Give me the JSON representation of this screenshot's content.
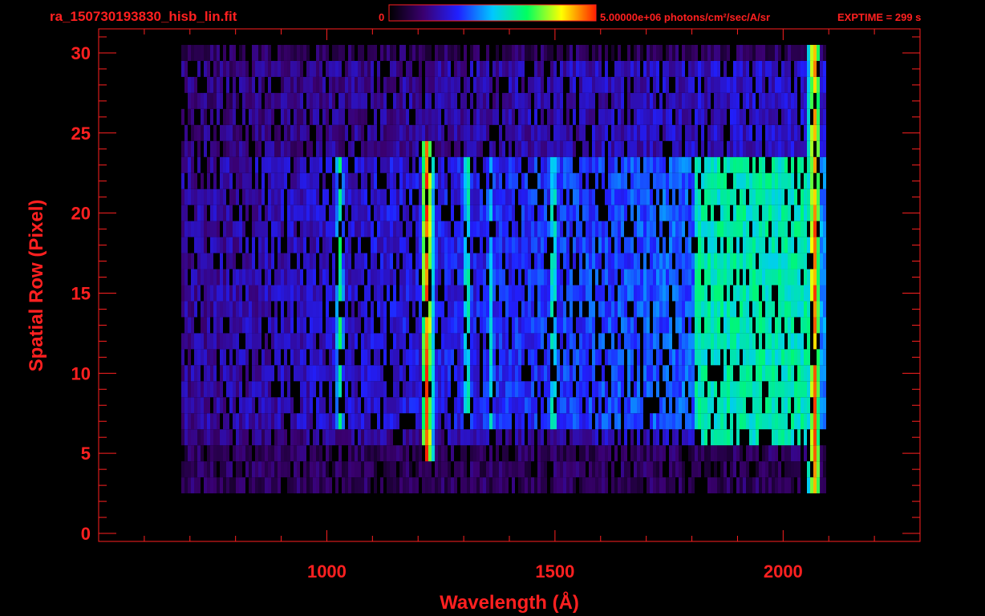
{
  "chart_data": {
    "type": "heatmap",
    "title": "ra_150730193830_hisb_lin.fit",
    "colorbar": {
      "min_label": "0",
      "max_label": "5.00000e+06 photons/cm²/sec/A/sr",
      "colormap": [
        "#000000",
        "#3a0070",
        "#2020ff",
        "#00c8ff",
        "#00ff60",
        "#ffff00",
        "#ff2000"
      ]
    },
    "exposure_label": "EXPTIME = 299 s",
    "xlabel": "Wavelength (Å)",
    "ylabel": "Spatial Row (Pixel)",
    "xlim": [
      500,
      2300
    ],
    "ylim": [
      -0.5,
      31.5
    ],
    "xticks": [
      1000,
      1500,
      2000
    ],
    "yticks": [
      0,
      5,
      10,
      15,
      20,
      25,
      30
    ],
    "grid": false,
    "background_color": "#000000",
    "axis_color": "#ff2020",
    "features": [
      {
        "name": "bright emission line",
        "wavelength": 1216,
        "row_range": [
          5,
          24
        ],
        "level": "high"
      },
      {
        "name": "emission line",
        "wavelength": 1025,
        "row_range": [
          7,
          23
        ],
        "level": "medium"
      },
      {
        "name": "emission line",
        "wavelength": 1304,
        "row_range": [
          7,
          23
        ],
        "level": "medium"
      },
      {
        "name": "emission line",
        "wavelength": 1356,
        "row_range": [
          7,
          23
        ],
        "level": "low"
      },
      {
        "name": "emission line",
        "wavelength": 1493,
        "row_range": [
          7,
          23
        ],
        "level": "medium"
      },
      {
        "name": "continuum band",
        "wavelength_range": [
          1800,
          2060
        ],
        "row_range": [
          6,
          23
        ],
        "level": "medium"
      },
      {
        "name": "edge line",
        "wavelength": 2065,
        "row_range": [
          0,
          30
        ],
        "level": "high"
      }
    ]
  }
}
